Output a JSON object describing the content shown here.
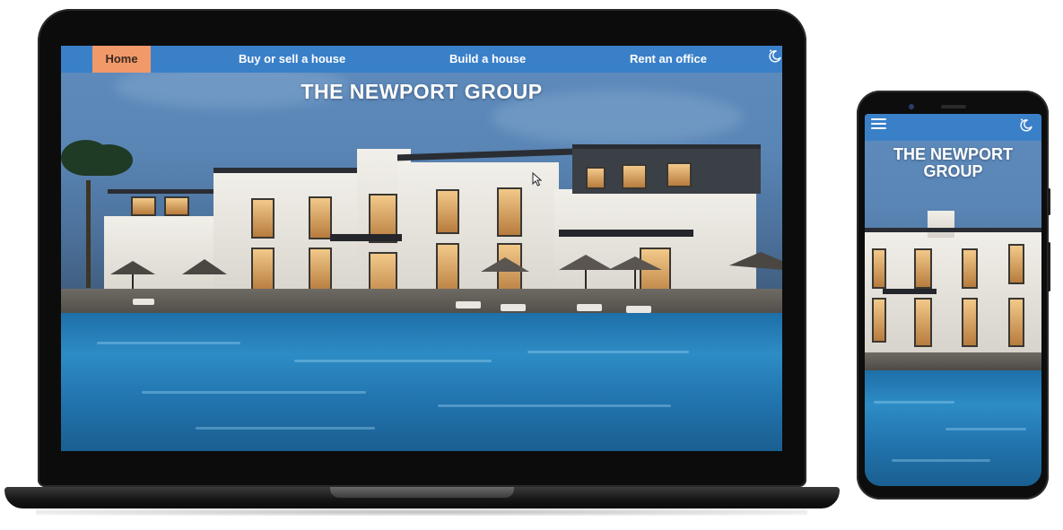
{
  "site": {
    "title": "THE NEWPORT GROUP",
    "title_line1": "THE NEWPORT",
    "title_line2": "GROUP"
  },
  "nav": {
    "items": [
      {
        "label": "Home",
        "active": true
      },
      {
        "label": "Buy or sell a house",
        "active": false
      },
      {
        "label": "Build a house",
        "active": false
      },
      {
        "label": "Rent an office",
        "active": false
      }
    ]
  },
  "icons": {
    "theme_toggle": "moon-sparkle-icon",
    "menu": "hamburger-menu-icon",
    "cursor": "mouse-pointer-icon"
  },
  "colors": {
    "nav_background": "#3a80c9",
    "active_tab_background": "#f2996a",
    "title_text": "#ffffff"
  }
}
